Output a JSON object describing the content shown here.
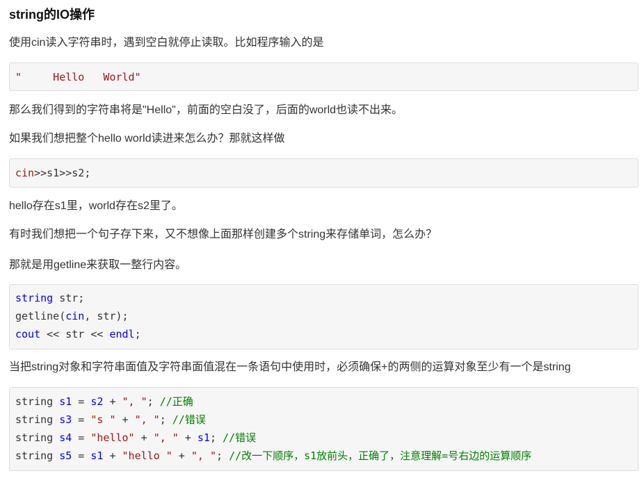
{
  "title": "string的IO操作",
  "paragraphs": {
    "p1": "使用cin读入字符串时，遇到空白就停止读取。比如程序输入的是",
    "p2": "那么我们得到的字符串将是\"Hello\"，前面的空白没了，后面的world也读不出来。",
    "p3": "如果我们想把整个hello world读进来怎么办？那就这样做",
    "p4": "hello存在s1里，world存在s2里了。",
    "p5": "有时我们想把一个句子存下来，又不想像上面那样创建多个string来存储单词，怎么办？",
    "p6": "那就是用getline来获取一整行内容。",
    "p7": "当把string对象和字符串面值及字符串面值混在一条语句中使用时，必须确保+的两侧的运算对象至少有一个是string"
  },
  "code1": {
    "line1": "\"     Hello   World\""
  },
  "code2": {
    "line1_a": "cin",
    "line1_b": ">>s1>>s2;"
  },
  "code3": {
    "line1_kw": "string",
    "line1_rest": " str;",
    "line2_a": "getline(",
    "line2_kw": "cin",
    "line2_b": ", str);",
    "line3_kw1": "cout",
    "line3_mid": " << str << ",
    "line3_kw2": "endl",
    "line3_end": ";"
  },
  "code4": {
    "l1": {
      "a": "string ",
      "v1": "s1",
      "b": " = ",
      "v2": "s2",
      "c": " + ",
      "s1": "\", \"",
      "d": "; ",
      "cm": "//正确"
    },
    "l2": {
      "a": "string ",
      "v1": "s3",
      "b": " = ",
      "s1": "\"s \"",
      "c": " + ",
      "s2": "\", \"",
      "d": "; ",
      "cm": "//错误"
    },
    "l3": {
      "a": "string ",
      "v1": "s4",
      "b": " = ",
      "s1": "\"hello\"",
      "c": " + ",
      "s2": "\", \"",
      "d": " + ",
      "v2": "s1",
      "e": "; ",
      "cm": "//错误"
    },
    "l4": {
      "a": "string ",
      "v1": "s5",
      "b": " = ",
      "v2": "s1",
      "c": " + ",
      "s1": "\"hello \"",
      "d": " + ",
      "s2": "\", \"",
      "e": "; ",
      "cm": "//改一下顺序，s1放前头，正确了，注意理解=号右边的运算顺序"
    }
  },
  "colors": {
    "string_literal": "#a31515",
    "keyword": "#0000ff",
    "comment": "#008000",
    "code_background": "#f6f6f6"
  }
}
